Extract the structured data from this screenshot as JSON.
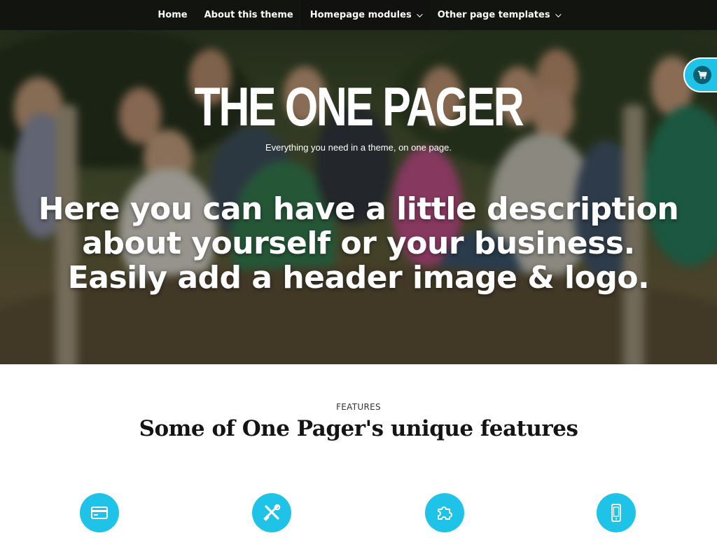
{
  "nav": {
    "items": [
      {
        "label": "Home",
        "has_dropdown": false
      },
      {
        "label": "About this theme",
        "has_dropdown": false
      },
      {
        "label": "Homepage modules",
        "has_dropdown": true
      },
      {
        "label": "Other page templates",
        "has_dropdown": true
      }
    ]
  },
  "hero": {
    "title": "THE ONE PAGER",
    "tagline": "Everything you need in a theme, on one page.",
    "description": "Here you can have a little description about yourself or your business. Easily add a header image & logo."
  },
  "cart": {
    "icon": "shopping-cart-icon"
  },
  "features": {
    "kicker": "FEATURES",
    "title": "Some of One Pager's unique features",
    "icons": [
      "credit-card-icon",
      "tools-icon",
      "puzzle-piece-icon",
      "mobile-phone-icon"
    ]
  },
  "colors": {
    "accent": "#1fc3e8",
    "nav_background": "#10120e",
    "nav_active": "#111210",
    "heading_text": "#141414"
  }
}
